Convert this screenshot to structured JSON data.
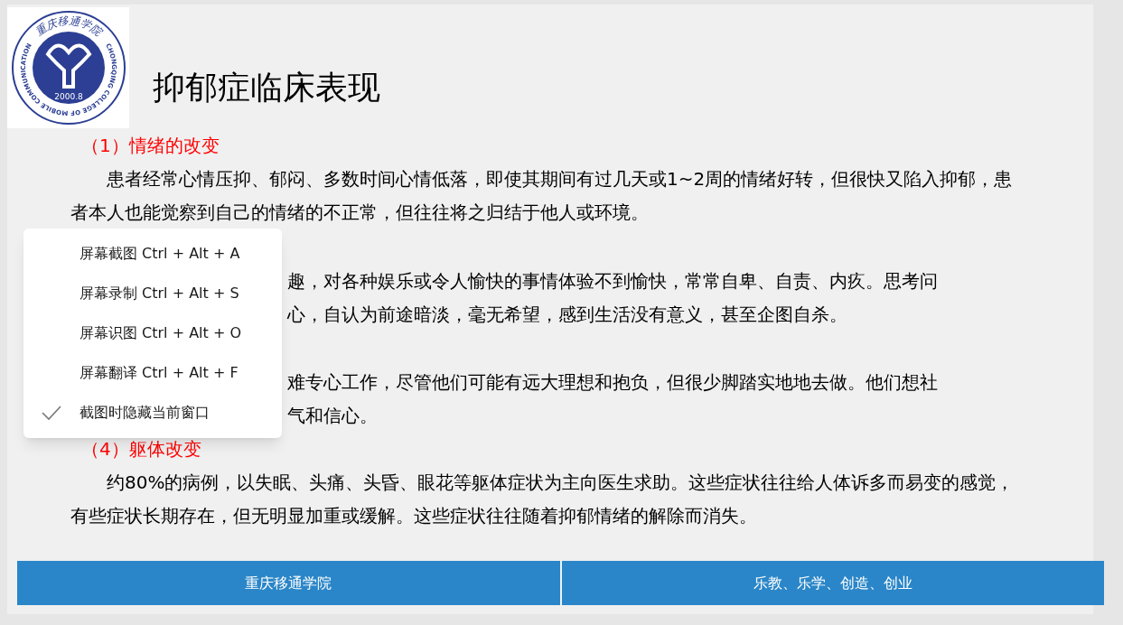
{
  "slide": {
    "logo": {
      "top_text": "重庆移通学院",
      "ring_text": "CHONGQING COLLEGE OF MOBILE COMMUNICATION",
      "year": "2000.8"
    },
    "title": "抑郁症临床表现",
    "sections": [
      {
        "kind": "full",
        "heading": "（1）情绪的改变",
        "body": "患者经常心情压抑、郁闷、多数时间心情低落，即使其期间有过几天或1~2周的情绪好转，但很快又陷入抑郁，患者本人也能觉察到自己的情绪的不正常，但往往将之归结于他人或环境。"
      },
      {
        "kind": "covered",
        "fragments": [
          "趣，对各种娱乐或令人愉快的事情体验不到愉快，常常自卑、自责、内疚。思考问",
          "心，自认为前途暗淡，毫无希望，感到生活没有意义，甚至企图自杀。"
        ]
      },
      {
        "kind": "covered",
        "fragments": [
          "难专心工作，尽管他们可能有远大理想和抱负，但很少脚踏实地地去做。他们想社",
          "气和信心。"
        ]
      },
      {
        "kind": "full",
        "heading": "（4）躯体改变",
        "body": "约80%的病例，以失眠、头痛、头昏、眼花等躯体症状为主向医生求助。这些症状往往给人体诉多而易变的感觉，有些症状长期存在，但无明显加重或缓解。这些症状往往随着抑郁情绪的解除而消失。"
      }
    ],
    "footer": [
      "重庆移通学院",
      "乐教、乐学、创造、创业"
    ]
  },
  "context_menu": [
    {
      "label": "屏幕截图 Ctrl + Alt + A",
      "checked": false
    },
    {
      "label": "屏幕录制 Ctrl + Alt + S",
      "checked": false
    },
    {
      "label": "屏幕识图 Ctrl + Alt + O",
      "checked": false
    },
    {
      "label": "屏幕翻译 Ctrl + Alt + F",
      "checked": false
    },
    {
      "label": "截图时隐藏当前窗口",
      "checked": true
    }
  ]
}
